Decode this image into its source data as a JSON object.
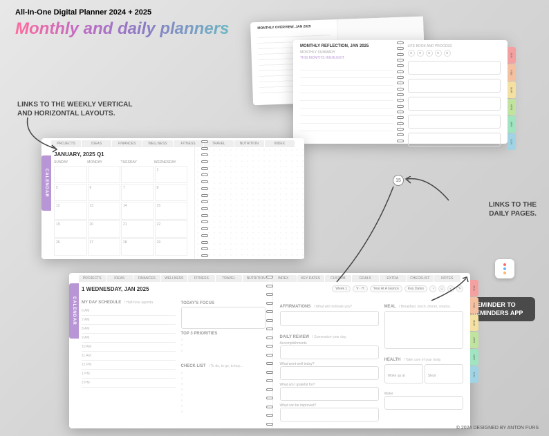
{
  "header": {
    "title": "All-In-One Digital Planner 2024 + 2025",
    "subtitle": "Monthly and daily planners"
  },
  "labels": {
    "weekly_links": "LINKS TO THE WEEKLY VERTICAL\nAND HORIZONTAL LAYOUTS.",
    "daily_links": "LINKS TO THE\nDAILY PAGES.",
    "reminder": "ADD A NEW REMINDER TO THE APPLE REMINDERS APP"
  },
  "footer": "© 2024 DESIGNED BY ANTON FURS",
  "monthly": {
    "side_tab": "CALENDAR",
    "top_tabs": [
      "PROJECTS",
      "IDEAS",
      "FINANCES",
      "WELLNESS",
      "FITNESS",
      "TRAVEL",
      "NUTRITION",
      "INDEX"
    ],
    "title": "JANUARY, 2025 Q1",
    "days": [
      "SUNDAY",
      "MONDAY",
      "TUESDAY",
      "WEDNESDAY"
    ],
    "dates": [
      "",
      "",
      "",
      "1",
      "5",
      "6",
      "7",
      "8",
      "12",
      "13",
      "14",
      "15",
      "19",
      "20",
      "21",
      "22",
      "26",
      "27",
      "28",
      "29"
    ],
    "circle_date": "15"
  },
  "daily": {
    "side_tab": "CALENDAR",
    "top_tabs": [
      "PROJECTS",
      "IDEAS",
      "FINANCES",
      "WELLNESS",
      "FITNESS",
      "TRAVEL",
      "NUTRITION",
      "INDEX",
      "KEY DATES",
      "CUSTOM",
      "GOALS",
      "EXTRA",
      "CHECKLIST",
      "NOTES"
    ],
    "title": "1 WEDNESDAY, JAN 2025",
    "toolbar": [
      "Week 1",
      "V · H",
      "Year At A Glance",
      "Key Dates"
    ],
    "schedule_label": "MY DAY SCHEDULE",
    "schedule_hint": "/ Half-hour agenda.",
    "focus_label": "TODAY'S FOCUS",
    "priorities_label": "TOP 3 PRIORITIES",
    "checklist_label": "CHECK LIST",
    "checklist_hint": "/ To do, to go, to buy...",
    "hours": [
      "6 AM",
      "7 AM",
      "8 AM",
      "9 AM",
      "10 AM",
      "11 AM",
      "12 PM",
      "1 PM",
      "2 PM"
    ],
    "affirmations_label": "AFFIRMATIONS",
    "affirmations_hint": "/ What will motivate you?",
    "meal_label": "MEAL",
    "meal_hint": "/ Breakfast, lunch, dinner, snacks.",
    "review_label": "DAILY REVIEW",
    "review_hint": "/ Summarize your day.",
    "accomplishments": "Accomplishments",
    "q1": "What went well today?",
    "q2": "What am I grateful for?",
    "q3": "What can be improved?",
    "health_label": "HEALTH",
    "health_hint": "/ Take care of your body.",
    "woke": "Woke up at",
    "slept": "Slept",
    "water": "Water",
    "month_tabs": {
      "labels": [
        "JAN",
        "FEB",
        "MAR",
        "APR",
        "MAY",
        "JUN"
      ],
      "colors": [
        "#f4a0a0",
        "#f4c0a0",
        "#f4e0a0",
        "#c0e4a0",
        "#a0e4c0",
        "#a0d4e4"
      ]
    }
  },
  "overview": {
    "title": "MONTHLY OVERVIEW, JAN 2025"
  },
  "reflection": {
    "title": "MONTHLY REFLECTION, JAN 2025",
    "sub": "MONTHLY SUMMARY",
    "highlight": "THIS MONTH'S HIGHLIGHT",
    "lifebook": "LIFE BOOK AND PROCESS"
  }
}
